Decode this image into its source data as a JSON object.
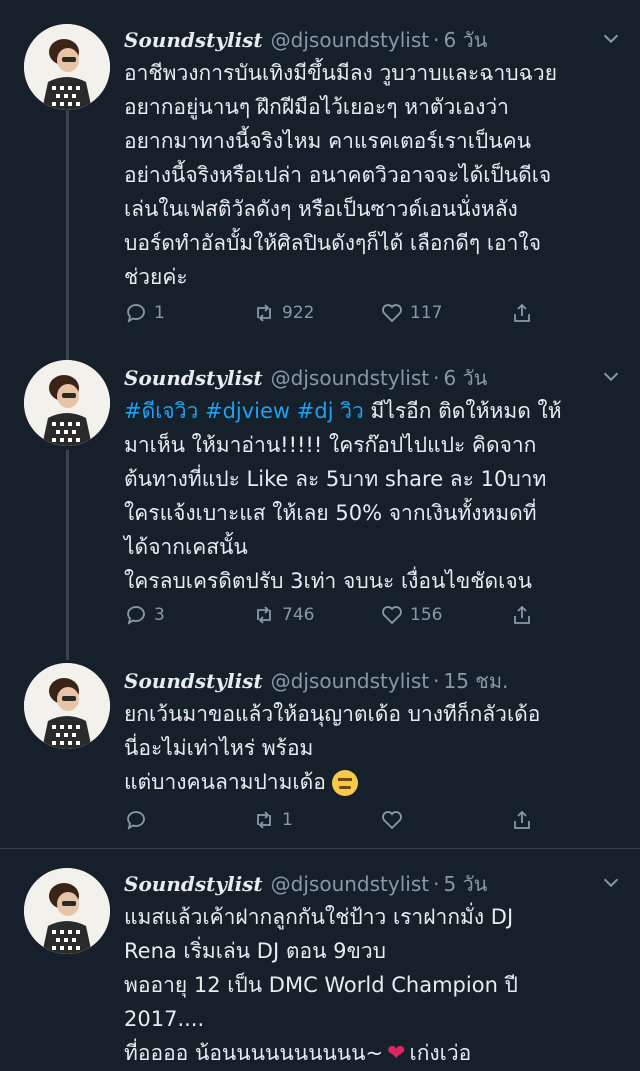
{
  "tweets": [
    {
      "name": "Soundstylist",
      "handle": "@djsoundstylist",
      "time": "6 วัน",
      "lines": [
        "อาชีพวงการบันเทิงมีขึ้นมีลง วูบวาบและฉาบฉวย",
        "อยากอยู่นานๆ ฝึกฝีมือไว้เยอะๆ หาตัวเองว่า",
        "อยากมาทางนี้จริงไหม คาแรคเตอร์เราเป็นคน",
        "อย่างนี้จริงหรือเปล่า อนาคตวิวอาจจะได้เป็นดีเจ",
        "เล่นในเฟสติวัลดังๆ หรือเป็นซาวด์เอนนั่งหลัง",
        "บอร์ดทำอัลบั้มให้ศิลปินดังๆก็ได้ เลือกดีๆ เอาใจ",
        "ช่วยค่ะ"
      ],
      "replies": "1",
      "retweets": "922",
      "likes": "117"
    },
    {
      "name": "Soundstylist",
      "handle": "@djsoundstylist",
      "time": "6 วัน",
      "hashtags": "#ดีเจวิว #djview #dj วิว",
      "line1_rest": " มีไรอีก ติดให้หมด ให้",
      "lines": [
        "มาเห็น ให้มาอ่าน!!!!! ใครก๊อปไปแปะ คิดจาก",
        "ต้นทางที่แปะ Like ละ 5บาท share ละ 10บาท",
        "ใครแจ้งเบาะแส ให้เลย 50% จากเงินทั้งหมดที่",
        "ได้จากเคสนั้น",
        "ใครลบเครดิตปรับ 3เท่า จบนะ เงื่อนไขชัดเจน"
      ],
      "replies": "3",
      "retweets": "746",
      "likes": "156"
    },
    {
      "name": "Soundstylist",
      "handle": "@djsoundstylist",
      "time": "15 ชม.",
      "lines": [
        "ยกเว้นมาขอแล้วให้อนุญาตเด้อ บางทีก็กลัวเด้อ",
        "นี่อะไม่เท่าไหร่ พร้อม",
        "แต่บางคนลามปามเด้อ"
      ],
      "replies": "",
      "retweets": "1",
      "likes": ""
    },
    {
      "name": "Soundstylist",
      "handle": "@djsoundstylist",
      "time": "5 วัน",
      "lines": [
        "แมสแล้วเค้าฝากลูกกันใช่ป้าว เราฝากมั่ง DJ",
        "Rena เริ่มเล่น DJ ตอน 9ขวบ",
        "พออายุ 12 เป็น DMC World Champion ปี",
        "2017....",
        "ที่ออออ น้อนนนนนนนนนน~",
        "เก่งเว่อ"
      ]
    }
  ]
}
